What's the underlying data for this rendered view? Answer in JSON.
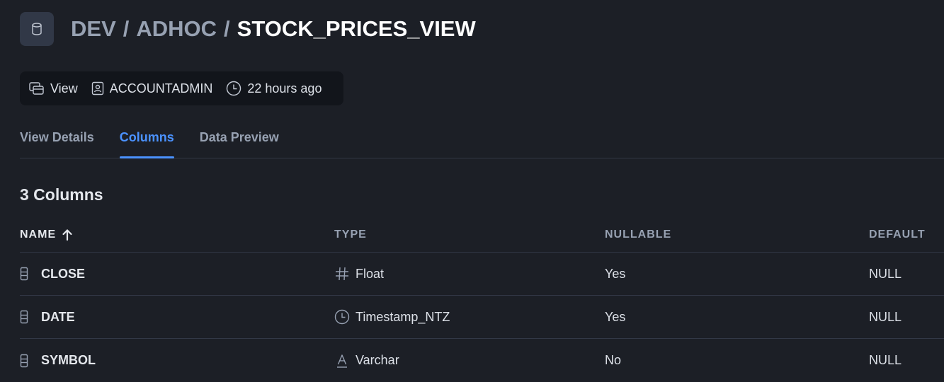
{
  "breadcrumb": {
    "database": "DEV",
    "schema": "ADHOC",
    "separator": "/",
    "object": "STOCK_PRICES_VIEW"
  },
  "meta": {
    "type": "View",
    "owner": "ACCOUNTADMIN",
    "modified": "22 hours ago"
  },
  "tabs": [
    {
      "label": "View Details",
      "active": false
    },
    {
      "label": "Columns",
      "active": true
    },
    {
      "label": "Data Preview",
      "active": false
    }
  ],
  "columns_section": {
    "title": "3 Columns"
  },
  "table": {
    "headers": {
      "name": "NAME",
      "type": "TYPE",
      "nullable": "NULLABLE",
      "default": "DEFAULT"
    },
    "sort": "name-ascending",
    "rows": [
      {
        "name": "CLOSE",
        "type": "Float",
        "type_icon": "hash-icon",
        "nullable": "Yes",
        "default": "NULL"
      },
      {
        "name": "DATE",
        "type": "Timestamp_NTZ",
        "type_icon": "clock-icon",
        "nullable": "Yes",
        "default": "NULL"
      },
      {
        "name": "SYMBOL",
        "type": "Varchar",
        "type_icon": "text-type-icon",
        "nullable": "No",
        "default": "NULL"
      }
    ]
  },
  "colors": {
    "background": "#1c1f26",
    "accent": "#4b92ff",
    "muted_text": "#97a1b2",
    "meta_bar": "#12151b"
  }
}
